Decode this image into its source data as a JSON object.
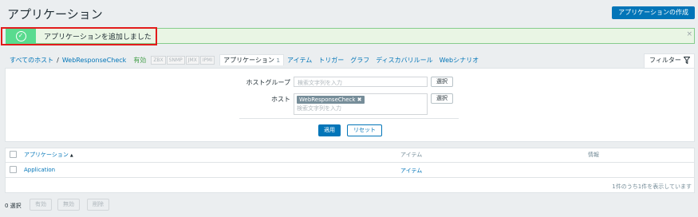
{
  "header": {
    "title": "アプリケーション",
    "create_button": "アプリケーションの作成"
  },
  "message": {
    "text": "アプリケーションを追加しました",
    "close": "×"
  },
  "nav": {
    "all_hosts": "すべてのホスト",
    "separator": "/",
    "host": "WebResponseCheck",
    "status": "有効",
    "tags": [
      "ZBX",
      "SNMP",
      "JMX",
      "IPMI"
    ],
    "tabs": [
      {
        "label": "アプリケーション",
        "count": "1",
        "active": true
      },
      {
        "label": "アイテム"
      },
      {
        "label": "トリガー"
      },
      {
        "label": "グラフ"
      },
      {
        "label": "ディスカバリルール"
      },
      {
        "label": "Webシナリオ"
      }
    ]
  },
  "filter": {
    "tab_label": "フィルター",
    "host_group_label": "ホストグループ",
    "host_group_placeholder": "検索文字列を入力",
    "host_label": "ホスト",
    "host_chip": "WebResponseCheck",
    "host_placeholder": "検索文字列を入力",
    "select_button": "選択",
    "apply_button": "適用",
    "reset_button": "リセット"
  },
  "table": {
    "columns": [
      "アプリケーション",
      "アイテム",
      "情報"
    ],
    "sort_indicator": "▲",
    "rows": [
      {
        "name": "Application",
        "items": "アイテム",
        "info": ""
      }
    ],
    "pagination": "1件のうち1件を表示しています"
  },
  "footer": {
    "selected": "0 選択",
    "buttons": [
      "有効",
      "無効",
      "削除"
    ]
  },
  "colors": {
    "accent": "#0275b8",
    "success": "#59db8f",
    "highlight": "#e21b1b"
  }
}
